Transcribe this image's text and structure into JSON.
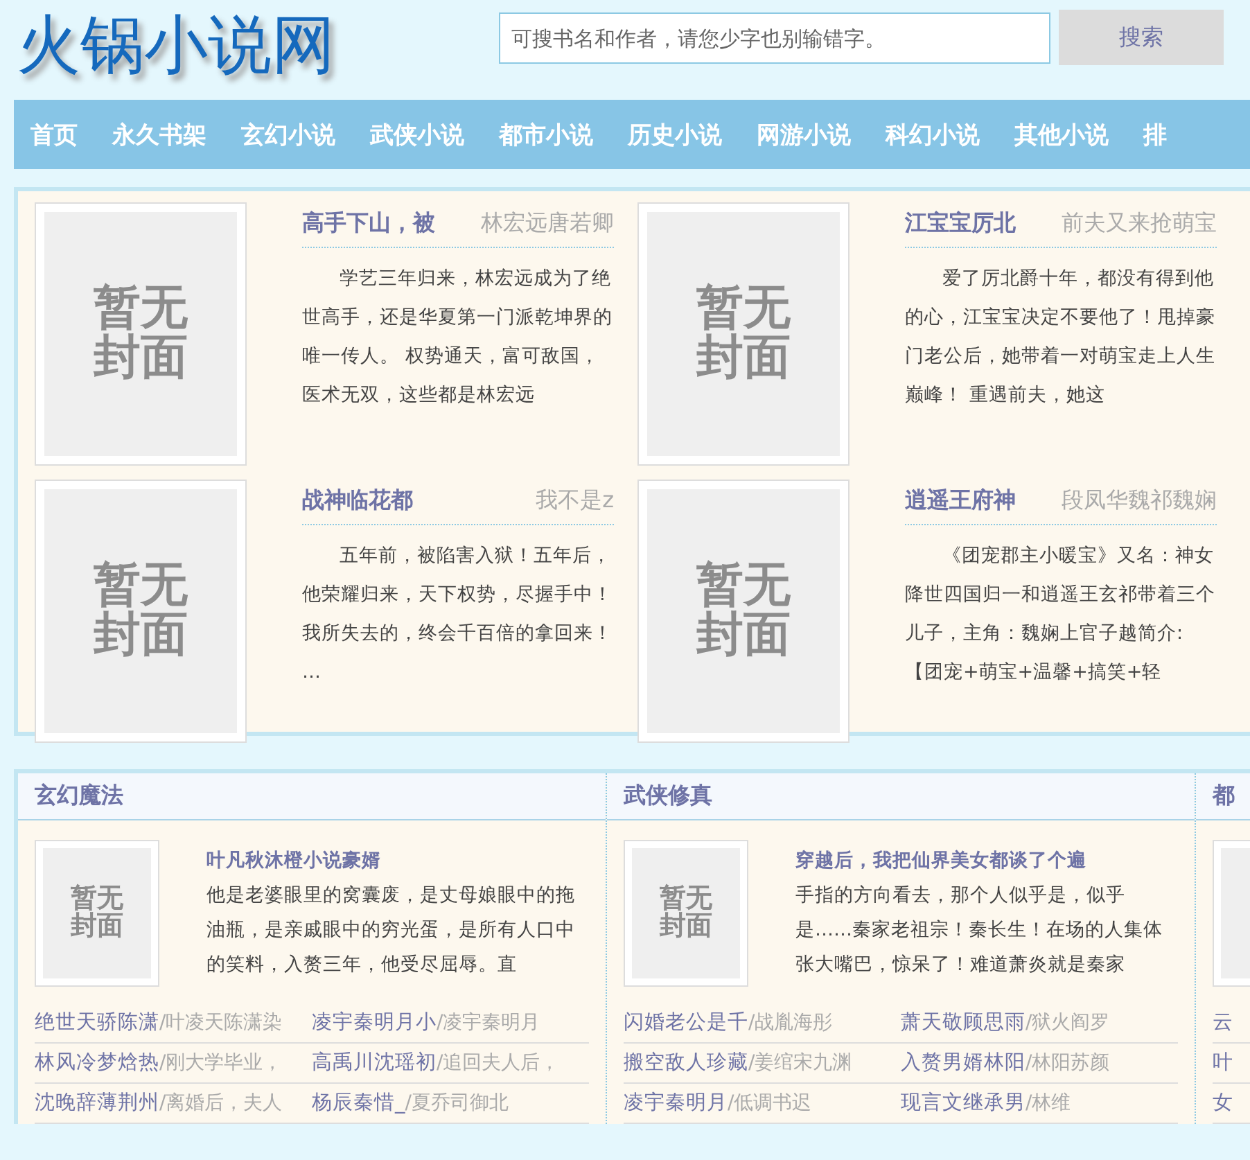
{
  "site_title": "火锅小说网",
  "search": {
    "placeholder": "可搜书名和作者，请您少字也别输错字。",
    "button": "搜索"
  },
  "nav": [
    "首页",
    "永久书架",
    "玄幻小说",
    "武侠小说",
    "都市小说",
    "历史小说",
    "网游小说",
    "科幻小说",
    "其他小说",
    "排"
  ],
  "featured": [
    {
      "title": "高手下山，被",
      "author": "林宏远唐若卿",
      "cover_label": "暂无封面",
      "summary": "学艺三年归来，林宏远成为了绝世高手，还是华夏第一门派乾坤界的唯一传人。 权势通天，富可敌国，医术无双，这些都是林宏远"
    },
    {
      "title": "江宝宝厉北",
      "author": "前夫又来抢萌宝",
      "cover_label": "暂无封面",
      "summary": "爱了厉北爵十年，都没有得到他的心，江宝宝决定不要他了！甩掉豪门老公后，她带着一对萌宝走上人生巅峰！ 重遇前夫，她这"
    },
    {
      "title": "战神临花都",
      "author": "我不是z",
      "cover_label": "暂无封面",
      "summary": "五年前，被陷害入狱！五年后，他荣耀归来，天下权势，尽握手中！我所失去的，终会千百倍的拿回来！ …"
    },
    {
      "title": "逍遥王府神",
      "author": "段凤华魏祁魏娴",
      "cover_label": "暂无封面",
      "summary": "《团宠郡主小暖宝》又名：神女降世四国归一和逍遥王玄祁带着三个儿子，主角：魏娴上官子越简介:【团宠+萌宝+温馨+搞笑+轻"
    }
  ],
  "sections": [
    {
      "heading": "玄幻魔法",
      "top": {
        "cover_label": "暂无封面",
        "title": "叶凡秋沐橙小说豪婿",
        "summary": "他是老婆眼里的窝囊废，是丈母娘眼中的拖油瓶，是亲戚眼中的穷光蛋，是所有人口中的笑料，入赘三年，他受尽屈辱。直"
      },
      "items": [
        {
          "title": "绝世天骄陈潇",
          "author": "/叶凌天陈潇染"
        },
        {
          "title": "凌宇秦明月小",
          "author": "/凌宇秦明月"
        },
        {
          "title": "林风冷梦焓热",
          "author": "/刚大学毕业，"
        },
        {
          "title": "高禹川沈瑶初",
          "author": "/追回夫人后，"
        },
        {
          "title": "沈晚辞薄荆州",
          "author": "/离婚后，夫人"
        },
        {
          "title": "杨辰秦惜_",
          "author": "/夏乔司御北"
        }
      ]
    },
    {
      "heading": "武侠修真",
      "top": {
        "cover_label": "暂无封面",
        "title": "穿越后，我把仙界美女都谈了个遍",
        "summary": "手指的方向看去，那个人似乎是，似乎是……秦家老祖宗！秦长生！在场的人集体张大嘴巴，惊呆了！难道萧炎就是秦家"
      },
      "items": [
        {
          "title": "闪婚老公是千",
          "author": "/战胤海彤"
        },
        {
          "title": "萧天敬顾思雨",
          "author": "/狱火阎罗"
        },
        {
          "title": "搬空敌人珍藏",
          "author": "/姜绾宋九渊"
        },
        {
          "title": "入赘男婿林阳",
          "author": "/林阳苏颜"
        },
        {
          "title": "凌宇秦明月",
          "author": "/低调书迟"
        },
        {
          "title": "现言文继承男",
          "author": "/林维"
        }
      ]
    },
    {
      "heading": "都",
      "items": [
        {
          "title": "云"
        },
        {
          "title": "叶"
        },
        {
          "title": "女"
        }
      ]
    }
  ]
}
